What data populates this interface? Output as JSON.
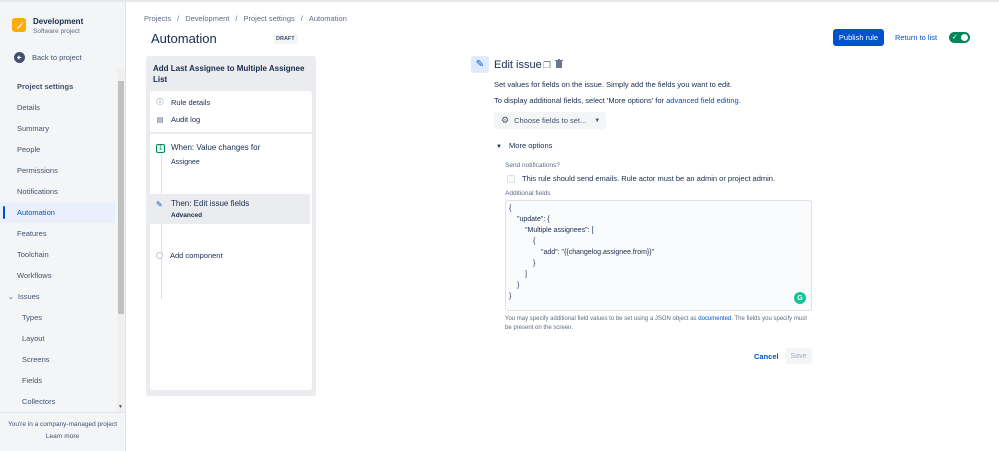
{
  "project": {
    "name": "Development",
    "type": "Software project"
  },
  "back_label": "Back to project",
  "nav_heading": "Project settings",
  "nav_items": [
    {
      "label": "Details"
    },
    {
      "label": "Summary"
    },
    {
      "label": "People"
    },
    {
      "label": "Permissions"
    },
    {
      "label": "Notifications"
    },
    {
      "label": "Automation"
    },
    {
      "label": "Features"
    },
    {
      "label": "Toolchain"
    },
    {
      "label": "Workflows"
    }
  ],
  "issues_group": {
    "label": "Issues",
    "items": [
      {
        "label": "Types"
      },
      {
        "label": "Layout"
      },
      {
        "label": "Screens"
      },
      {
        "label": "Fields"
      },
      {
        "label": "Collectors"
      }
    ]
  },
  "sidebar_footer": {
    "note": "You're in a company-managed project",
    "learn_more": "Learn more"
  },
  "breadcrumbs": [
    "Projects",
    "Development",
    "Project settings",
    "Automation"
  ],
  "page_title": "Automation",
  "draft_badge": "DRAFT",
  "header_actions": {
    "publish": "Publish rule",
    "return": "Return to list",
    "enabled": true
  },
  "rule": {
    "title": "Add Last Assignee to Multiple Assignee List",
    "rule_details": "Rule details",
    "audit_log": "Audit log",
    "trigger": {
      "title": "When: Value changes for",
      "subtitle": "Assignee"
    },
    "action": {
      "title": "Then: Edit issue fields",
      "subtitle": "Advanced"
    },
    "add_component": "Add component"
  },
  "editor": {
    "title": "Edit issue",
    "description": "Set values for fields on the issue. Simply add the fields you want to edit.",
    "additional_prefix": "To display additional fields, select 'More options' for",
    "additional_link": "advanced field editing.",
    "choose_fields": "Choose fields to set...",
    "more_options": "More options",
    "send_notifications_label": "Send notifications?",
    "send_notifications_text": "This rule should send emails. Rule actor must be an admin or project admin.",
    "additional_fields_label": "Additional fields",
    "code_lines": [
      "{",
      "\"update\": {",
      "\"Multiple assignees\": [",
      "{",
      "\"add\": \"{{changelog.assignee.from}}\"",
      "}",
      "]",
      "}",
      "}"
    ],
    "help_prefix": "You may specify additional field values to be set using a JSON object as",
    "help_link": "documented",
    "help_suffix": ". The fields you specify must be present on the screen.",
    "cancel": "Cancel",
    "save": "Save"
  }
}
